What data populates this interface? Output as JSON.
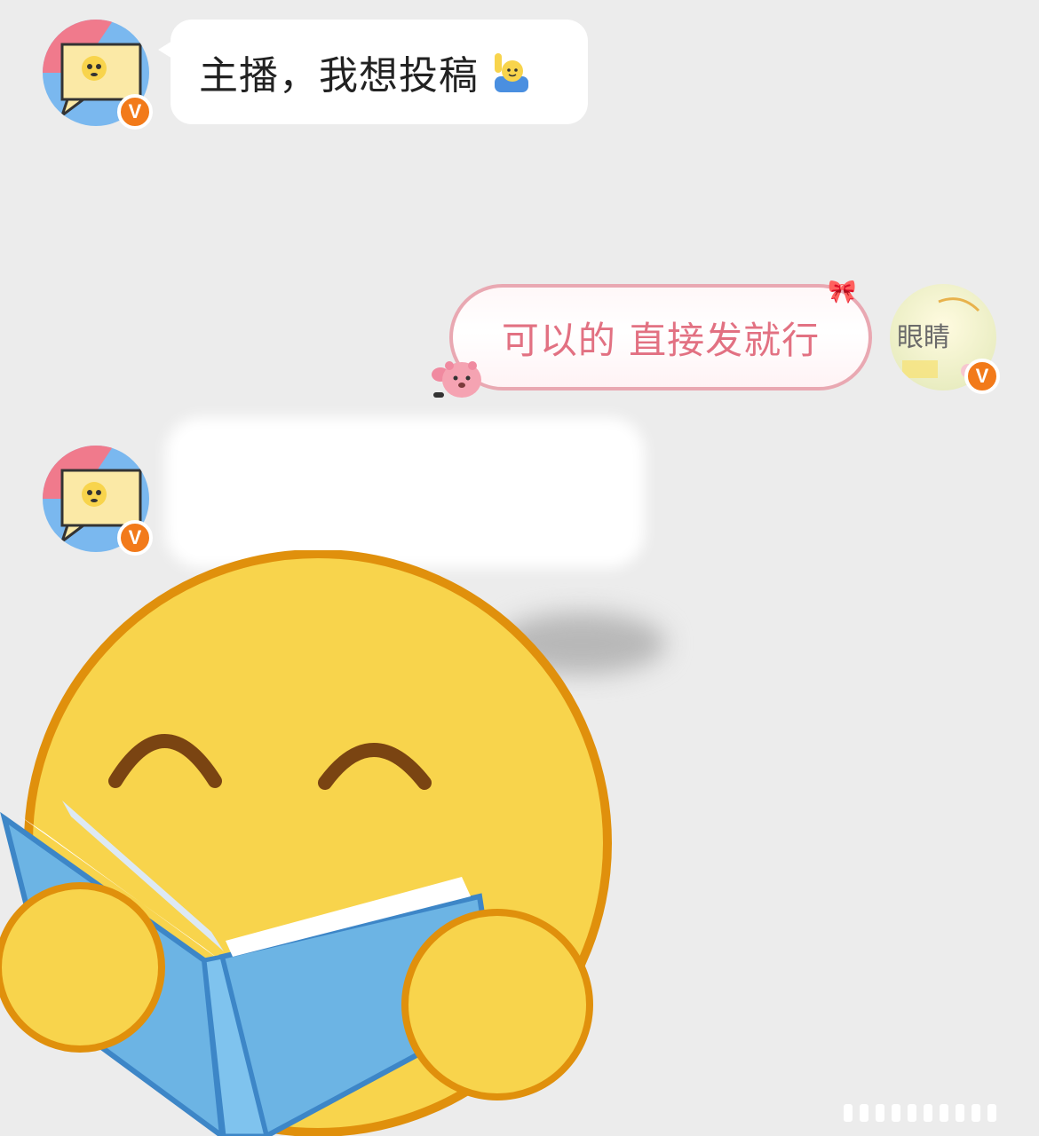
{
  "messages": [
    {
      "sender": "left",
      "text": "主播，我想投稿",
      "emoji": "person-raising-hand"
    },
    {
      "sender": "right",
      "text": "可以的 直接发就行",
      "decoration": "bow-and-beaver"
    },
    {
      "sender": "left",
      "text": "",
      "note_hidden": true
    }
  ],
  "avatars": {
    "left_badge": "V",
    "right_badge": "V",
    "right_avatar_text": "眼睛"
  },
  "colors": {
    "background": "#ececec",
    "right_bubble_border": "#e9a8b2",
    "right_bubble_text": "#e27182",
    "verified_badge": "#f27a1a",
    "sticker_face": "#f8d44c",
    "sticker_book": "#6cb4e4"
  },
  "sticker": {
    "name": "reading-book-emoji"
  }
}
